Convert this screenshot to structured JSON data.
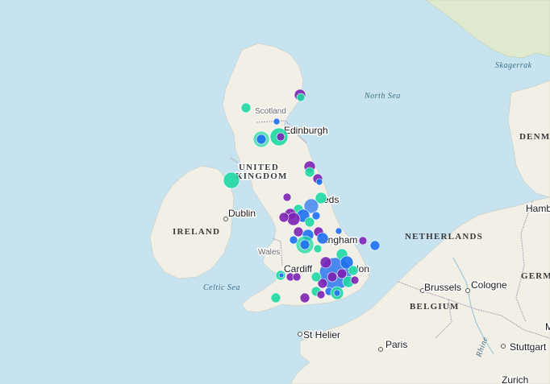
{
  "map": {
    "labels": {
      "north_sea": "North Sea",
      "skagerrak": "Skagerrak",
      "celtic_sea": "Celtic Sea",
      "scotland": "Scotland",
      "edinburgh": "Edinburgh",
      "uk_line1": "UNITED",
      "uk_line2": "KINGDOM",
      "ireland": "IRELAND",
      "dublin": "Dublin",
      "wales": "Wales",
      "leeds": "eds",
      "birmingham": "ingham",
      "cardiff": "Cardiff",
      "london": "don",
      "netherlands": "NETHERLANDS",
      "denmark": "DENMAR",
      "germany": "GERMANY",
      "belgium": "BELGIUM",
      "brussels": "Brussels",
      "cologne": "Cologne",
      "hamburg": "Hamb",
      "paris": "Paris",
      "st_helier": "St Helier",
      "stuttgart": "Stuttgart",
      "rhine": "Rhine",
      "zurich": "Zurich",
      "m_partial": "M"
    },
    "colors": {
      "water": "#c6e3ef",
      "land": "#f2f0e6",
      "land_green": "#dfe9cf",
      "border": "#b69ab5",
      "teal": "#1fd8a3",
      "blue": "#1e6ff0",
      "purple": "#7b22b3"
    }
  }
}
